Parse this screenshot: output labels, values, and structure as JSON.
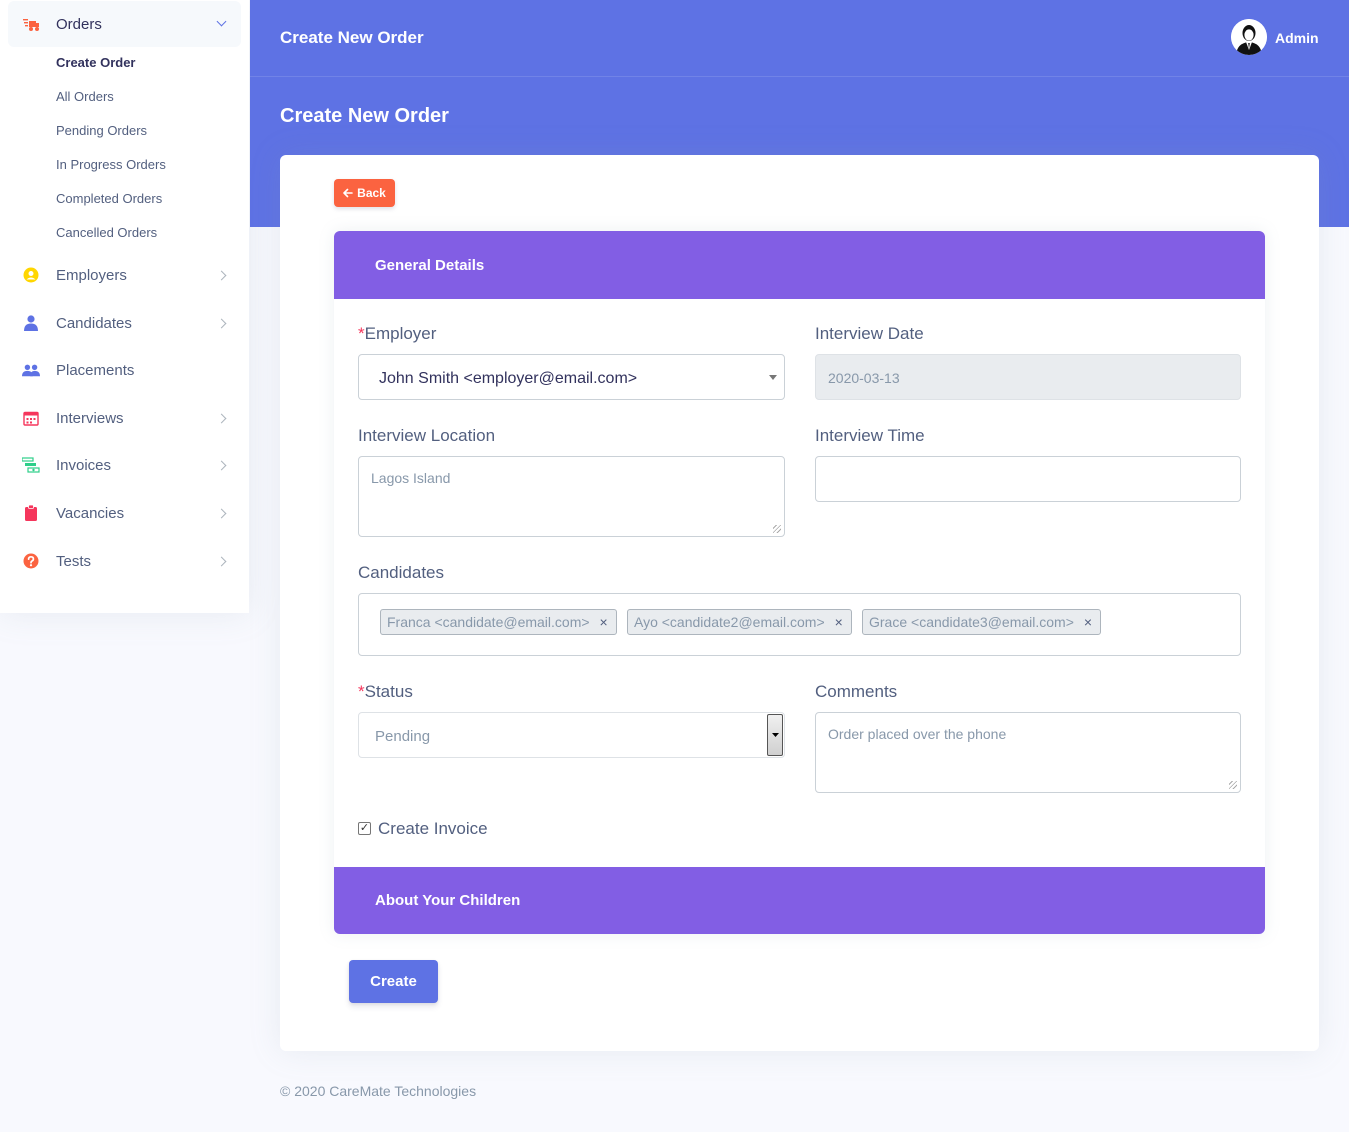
{
  "sidebar": {
    "orders_label": "Orders",
    "sub_items": [
      "Create Order",
      "All Orders",
      "Pending Orders",
      "In Progress Orders",
      "Completed Orders",
      "Cancelled Orders"
    ],
    "items": [
      {
        "label": "Employers",
        "icon": "user-circle-icon",
        "color": "#ffd600"
      },
      {
        "label": "Candidates",
        "icon": "user-icon",
        "color": "#5e72e4"
      },
      {
        "label": "Placements",
        "icon": "users-icon",
        "color": "#5e72e4"
      },
      {
        "label": "Interviews",
        "icon": "calendar-icon",
        "color": "#f5365c"
      },
      {
        "label": "Invoices",
        "icon": "money-icon",
        "color": "#2dce89"
      },
      {
        "label": "Vacancies",
        "icon": "clipboard-icon",
        "color": "#f5365c"
      },
      {
        "label": "Tests",
        "icon": "question-icon",
        "color": "#fb6340"
      }
    ]
  },
  "header": {
    "title": "Create New Order",
    "user_name": "Admin"
  },
  "page": {
    "title": "Create New Order",
    "back_label": "Back",
    "general_details": "General Details",
    "about_children": "About Your Children",
    "create_label": "Create"
  },
  "form": {
    "employer_label": "Employer",
    "employer_value": "John Smith <employer@email.com>",
    "interview_date_label": "Interview Date",
    "interview_date_value": "2020-03-13",
    "interview_location_label": "Interview Location",
    "interview_location_value": "Lagos Island",
    "interview_time_label": "Interview Time",
    "interview_time_value": "",
    "candidates_label": "Candidates",
    "candidates": [
      "Franca <candidate@email.com>",
      "Ayo <candidate2@email.com>",
      "Grace <candidate3@email.com>"
    ],
    "status_label": "Status",
    "status_value": "Pending",
    "comments_label": "Comments",
    "comments_value": "Order placed over the phone",
    "create_invoice_label": "Create Invoice",
    "create_invoice_checked": true,
    "required_mark": "*",
    "tag_remove": "×"
  },
  "footer": {
    "text": "© 2020 CareMate Technologies"
  },
  "colors": {
    "primary": "#5e72e4",
    "section": "#825ee4",
    "warning": "#fb6340",
    "background": "#f8f9fe"
  }
}
